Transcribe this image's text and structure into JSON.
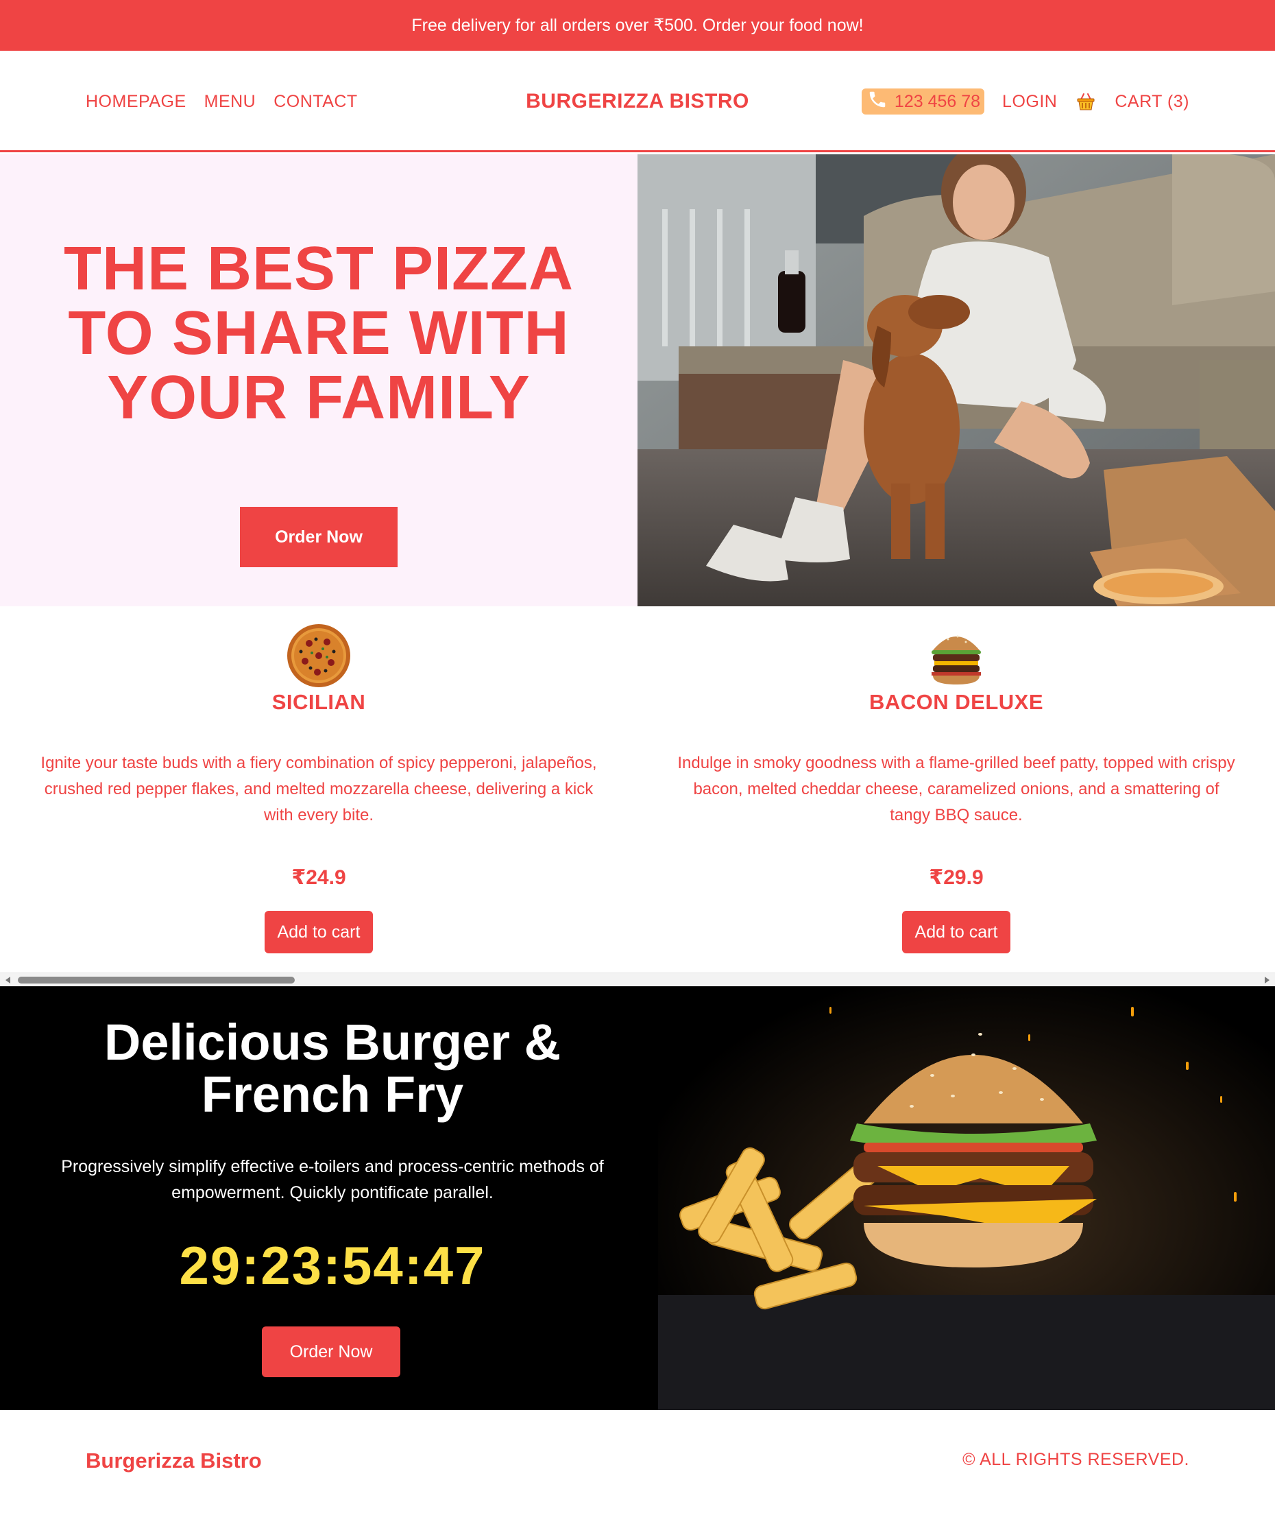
{
  "promo_bar": {
    "text": "Free delivery for all orders over ₹500. Order your food now!"
  },
  "header": {
    "nav": [
      "HOMEPAGE",
      "MENU",
      "CONTACT"
    ],
    "brand": "BURGERIZZA BISTRO",
    "phone": "123 456 78",
    "login": "LOGIN",
    "cart": "CART (3)",
    "phone_pill_color": "#fdba74",
    "icons": {
      "phone": "phone-icon",
      "cart": "basket-icon"
    }
  },
  "hero": {
    "title": "THE BEST PIZZA TO SHARE WITH YOUR FAMILY",
    "button": "Order Now",
    "background": "#fdf2fb"
  },
  "products": [
    {
      "name": "SICILIAN",
      "description": "Ignite your taste buds with a fiery combination of spicy pepperoni, jalapeños, crushed red pepper flakes, and melted mozzarella cheese, delivering a kick with every bite.",
      "price": "₹24.9",
      "button": "Add to cart",
      "icon": "pizza-icon"
    },
    {
      "name": "BACON DELUXE",
      "description": "Indulge in smoky goodness with a flame-grilled beef patty, topped with crispy bacon, melted cheddar cheese, caramelized onions, and a smattering of tangy BBQ sauce.",
      "price": "₹29.9",
      "button": "Add to cart",
      "icon": "burger-icon"
    }
  ],
  "promo_section": {
    "title": "Delicious Burger & French Fry",
    "description": "Progressively simplify effective e-toilers and process-centric methods of empowerment. Quickly pontificate parallel.",
    "countdown": "29:23:54:47",
    "button": "Order Now",
    "countdown_color": "#fde047"
  },
  "footer": {
    "brand": "Burgerizza Bistro",
    "copyright": "© ALL RIGHTS RESERVED."
  },
  "colors": {
    "accent": "#ef4444",
    "dark": "#000000"
  }
}
